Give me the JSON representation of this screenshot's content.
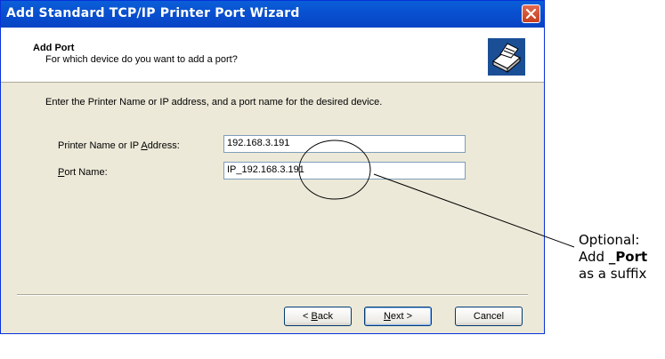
{
  "window": {
    "title": "Add Standard TCP/IP Printer Port Wizard"
  },
  "header": {
    "title": "Add Port",
    "subtitle": "For which device do you want to add a port?"
  },
  "body": {
    "instruction": "Enter the Printer Name or IP address, and a port name for the desired device."
  },
  "fields": {
    "printer_label_pre": "Printer Name or IP ",
    "printer_label_accel": "A",
    "printer_label_post": "ddress:",
    "printer_value": "192.168.3.191",
    "port_label_accel": "P",
    "port_label_post": "ort Name:",
    "port_value": "IP_192.168.3.191"
  },
  "buttons": {
    "back_prefix": "< ",
    "back_accel": "B",
    "back_post": "ack",
    "next_accel": "N",
    "next_post": "ext >",
    "cancel": "Cancel"
  },
  "annotation": {
    "line1": "Optional:",
    "line2_pre": "Add ",
    "line2_bold": "_Port",
    "line3": "as a suffix"
  },
  "colors": {
    "titlebar": "#0a5fd8",
    "dialog_bg": "#ece9d8"
  },
  "icons": [
    "close-icon",
    "printer-icon"
  ]
}
